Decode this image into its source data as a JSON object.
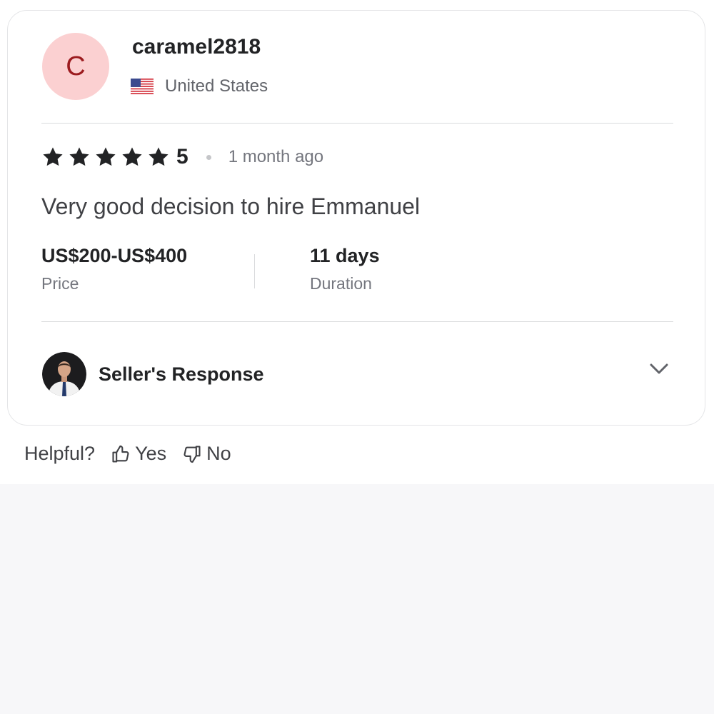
{
  "review": {
    "avatar_initial": "C",
    "username": "caramel2818",
    "country": "United States",
    "country_flag_icon": "us-flag-icon",
    "rating": {
      "stars": 5,
      "value": "5",
      "icon": "star-icon",
      "color": "#222325"
    },
    "time_ago": "1 month ago",
    "text": "Very good decision to hire Emmanuel",
    "price": {
      "value": "US$200-US$400",
      "label": "Price"
    },
    "duration": {
      "value": "11 days",
      "label": "Duration"
    },
    "seller_response": {
      "label": "Seller's Response",
      "expand_icon": "chevron-down-icon"
    }
  },
  "helpful": {
    "question": "Helpful?",
    "yes_label": "Yes",
    "no_label": "No",
    "yes_icon": "thumbs-up-icon",
    "no_icon": "thumbs-down-icon"
  },
  "colors": {
    "avatar_bg": "#fbd0d1",
    "avatar_text": "#9c1b1f",
    "page_bg_lower": "#f7f7f9"
  }
}
